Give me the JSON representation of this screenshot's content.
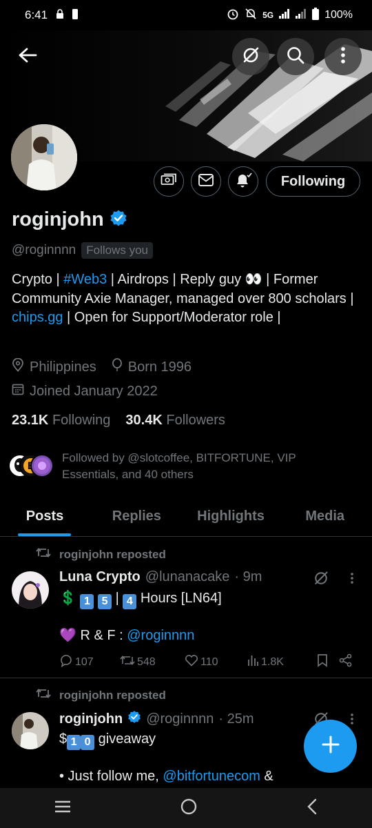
{
  "status_bar": {
    "time": "6:41",
    "network": "5G",
    "battery": "100%"
  },
  "header": {
    "icons": [
      "arrow-left-icon",
      "grok-icon",
      "search-icon",
      "more-vertical-icon"
    ]
  },
  "profile": {
    "display_name": "roginjohn",
    "handle": "@roginnnn",
    "follows_you": "Follows you",
    "bio_parts": {
      "p1": "Crypto | ",
      "hashtag": "#Web3",
      "p2": " | Airdrops | Reply guy 👀 | Former Community Axie Manager, managed over 800 scholars | ",
      "link": "chips.gg",
      "p3": " | Open for Support/Moderator role |"
    },
    "location": "Philippines",
    "born": "Born 1996",
    "joined": "Joined January 2022",
    "following_count": "23.1K",
    "following_label": "Following",
    "followers_count": "30.4K",
    "followers_label": "Followers",
    "followed_by": "Followed by @slotcoffee, BITFORTUNE, VIP Essentials, and 40 others",
    "following_button": "Following"
  },
  "tabs": [
    {
      "label": "Posts",
      "active": true
    },
    {
      "label": "Replies",
      "active": false
    },
    {
      "label": "Highlights",
      "active": false
    },
    {
      "label": "Media",
      "active": false
    }
  ],
  "posts": [
    {
      "repost_label": "roginjohn reposted",
      "name": "Luna Crypto",
      "handle": "@lunanacake",
      "time": "· 9m",
      "line1_prefix": "💲",
      "line1_box1": "1",
      "line1_box2": "5",
      "line1_mid": " | ",
      "line1_box3": "4",
      "line1_suffix": " Hours [LN64]",
      "line2_prefix": "💜 R & F : ",
      "line2_mention": "@roginnnn",
      "replies": "107",
      "reposts": "548",
      "likes": "110",
      "views": "1.8K"
    },
    {
      "repost_label": "roginjohn reposted",
      "name": "roginjohn",
      "handle": "@roginnnn",
      "time": "· 25m",
      "line1_prefix": "$",
      "line1_box1": "1",
      "line1_box2": "0",
      "line1_suffix": " giveaway",
      "line2_prefix": "• Just follow me, ",
      "line2_mention": "@bitfortunecom",
      "line2_suffix": " &"
    }
  ],
  "colors": {
    "accent": "#1d9bf0",
    "background": "#000000",
    "secondary_text": "#71767b",
    "primary_text": "#e7e9ea"
  }
}
